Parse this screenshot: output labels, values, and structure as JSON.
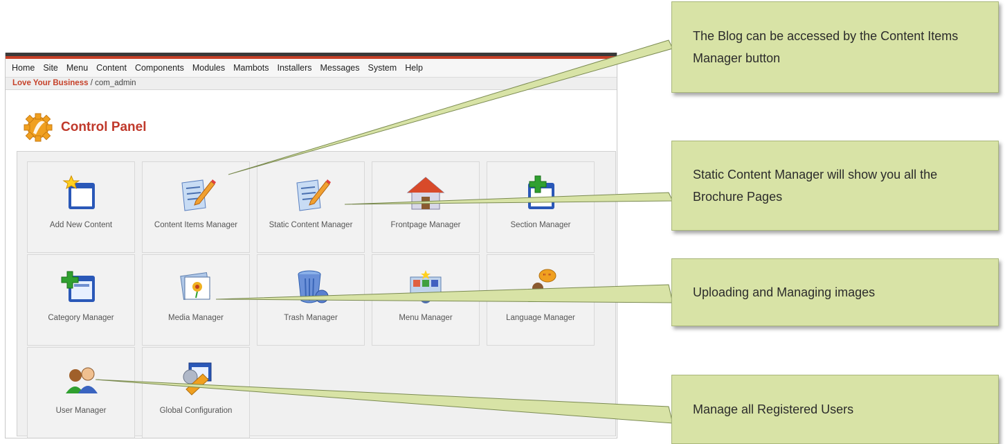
{
  "menu": [
    "Home",
    "Site",
    "Menu",
    "Content",
    "Components",
    "Modules",
    "Mambots",
    "Installers",
    "Messages",
    "System",
    "Help"
  ],
  "breadcrumb": {
    "site": "Love Your Business",
    "path": " / com_admin"
  },
  "page_title": "Control Panel",
  "tiles": [
    {
      "label": "Add New Content",
      "icon": "add-content-icon"
    },
    {
      "label": "Content Items Manager",
      "icon": "content-items-icon"
    },
    {
      "label": "Static Content Manager",
      "icon": "static-content-icon"
    },
    {
      "label": "Frontpage Manager",
      "icon": "frontpage-house-icon"
    },
    {
      "label": "Section Manager",
      "icon": "section-icon"
    },
    {
      "label": "Category Manager",
      "icon": "category-icon"
    },
    {
      "label": "Media Manager",
      "icon": "media-icon"
    },
    {
      "label": "Trash Manager",
      "icon": "trash-icon"
    },
    {
      "label": "Menu Manager",
      "icon": "menu-icon"
    },
    {
      "label": "Language Manager",
      "icon": "language-icon"
    },
    {
      "label": "User Manager",
      "icon": "users-icon"
    },
    {
      "label": "Global Configuration",
      "icon": "config-icon"
    }
  ],
  "callouts": [
    {
      "text": "The Blog can be accessed by the Content Items Manager button"
    },
    {
      "text": "Static Content Manager will show you all the Brochure Pages"
    },
    {
      "text": "Uploading and Managing images"
    },
    {
      "text": "Manage all Registered Users"
    }
  ],
  "colors": {
    "accent_red": "#c64028",
    "callout_bg": "#d8e3a6"
  }
}
